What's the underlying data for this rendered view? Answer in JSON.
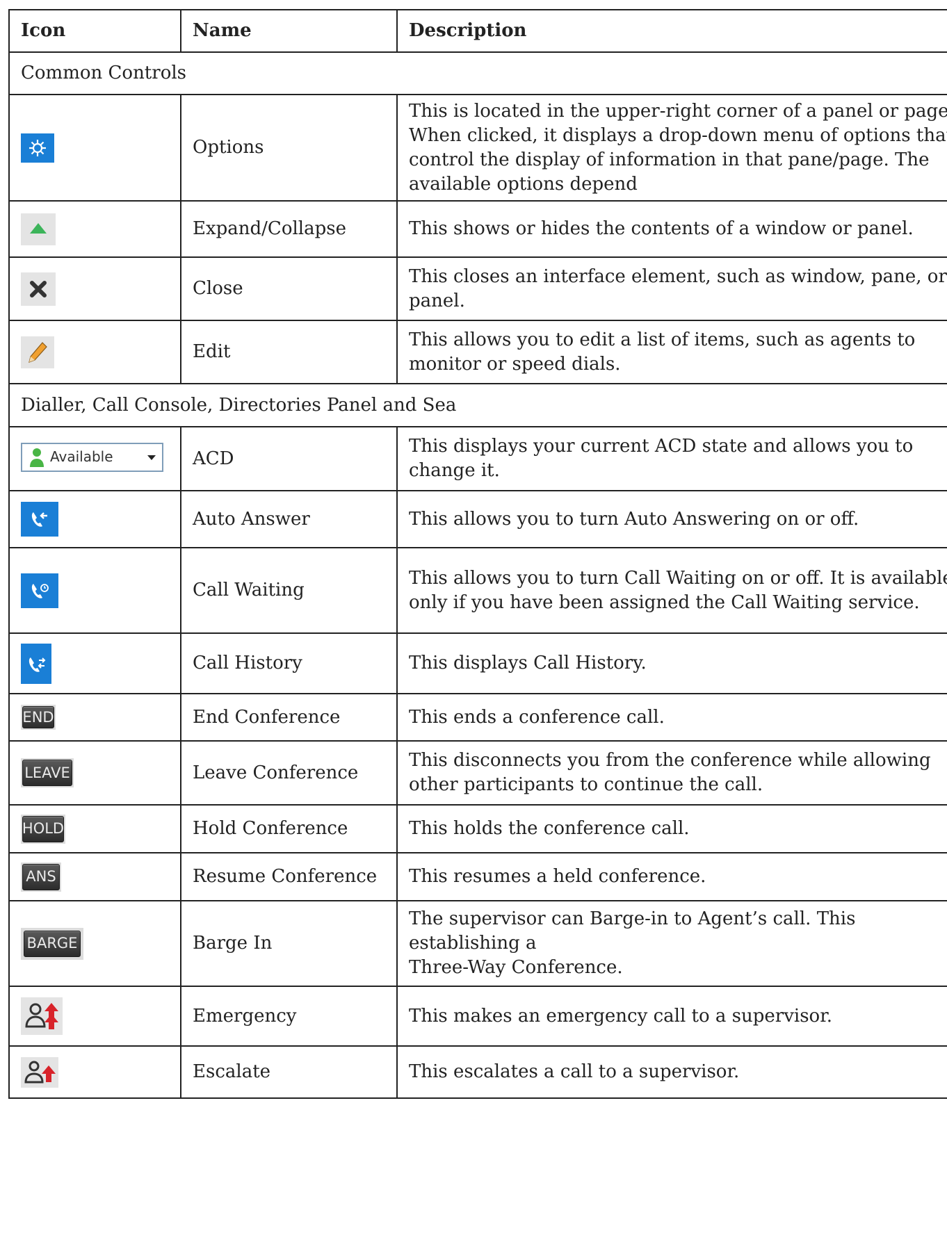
{
  "header": {
    "icon": "Icon",
    "name": "Name",
    "description": "Description"
  },
  "sections": [
    {
      "title": "Common Controls",
      "rows": [
        {
          "icon": "gear-icon",
          "name": "Options",
          "description": "This is located in the upper-right corner of a panel or page. When clicked, it displays a drop-down menu of options that control the display of information in that pane/page. The available options depend"
        },
        {
          "icon": "expand-collapse-icon",
          "name": "Expand/Collapse",
          "description": "This shows or hides the contents of a window or panel."
        },
        {
          "icon": "close-icon",
          "name": "Close",
          "description": "This closes an interface element, such as window, pane, or panel."
        },
        {
          "icon": "pencil-icon",
          "name": "Edit",
          "description": "This allows you to edit a list of items, such as agents to monitor or speed dials."
        }
      ]
    },
    {
      "title": "Dialler, Call Console, Directories Panel and Sea",
      "rows": [
        {
          "icon": "acd-dropdown",
          "icon_text": "Available",
          "name": "ACD",
          "description": "This displays your current ACD state and allows you to change it."
        },
        {
          "icon": "auto-answer-icon",
          "name": "Auto Answer",
          "description": "This allows you to turn Auto Answering on or off."
        },
        {
          "icon": "call-waiting-icon",
          "name": "Call Waiting",
          "description": "This allows you to turn Call Waiting on or off. It is available only if you have been assigned the Call Waiting service."
        },
        {
          "icon": "call-history-icon",
          "name": "Call History",
          "description": "This displays Call History."
        },
        {
          "icon": "end-button-icon",
          "icon_text": "END",
          "name": "End Conference",
          "description": "This ends a conference call."
        },
        {
          "icon": "leave-button-icon",
          "icon_text": "LEAVE",
          "name": "Leave Conference",
          "description": "This disconnects you from the conference while allowing other participants to continue the call."
        },
        {
          "icon": "hold-button-icon",
          "icon_text": "HOLD",
          "name": "Hold Conference",
          "description": "This holds the conference call."
        },
        {
          "icon": "ans-button-icon",
          "icon_text": "ANS",
          "name": "Resume Conference",
          "description": "This resumes a held conference."
        },
        {
          "icon": "barge-button-icon",
          "icon_text": "BARGE",
          "name": "Barge In",
          "description_lines": [
            "The supervisor can Barge-in to Agent’s call. This establishing a",
            "Three-Way Conference."
          ]
        },
        {
          "icon": "emergency-icon",
          "name": "Emergency",
          "description": "This makes an emergency call to a supervisor."
        },
        {
          "icon": "escalate-icon",
          "name": "Escalate",
          "description": "This escalates a call to a supervisor."
        }
      ]
    }
  ]
}
